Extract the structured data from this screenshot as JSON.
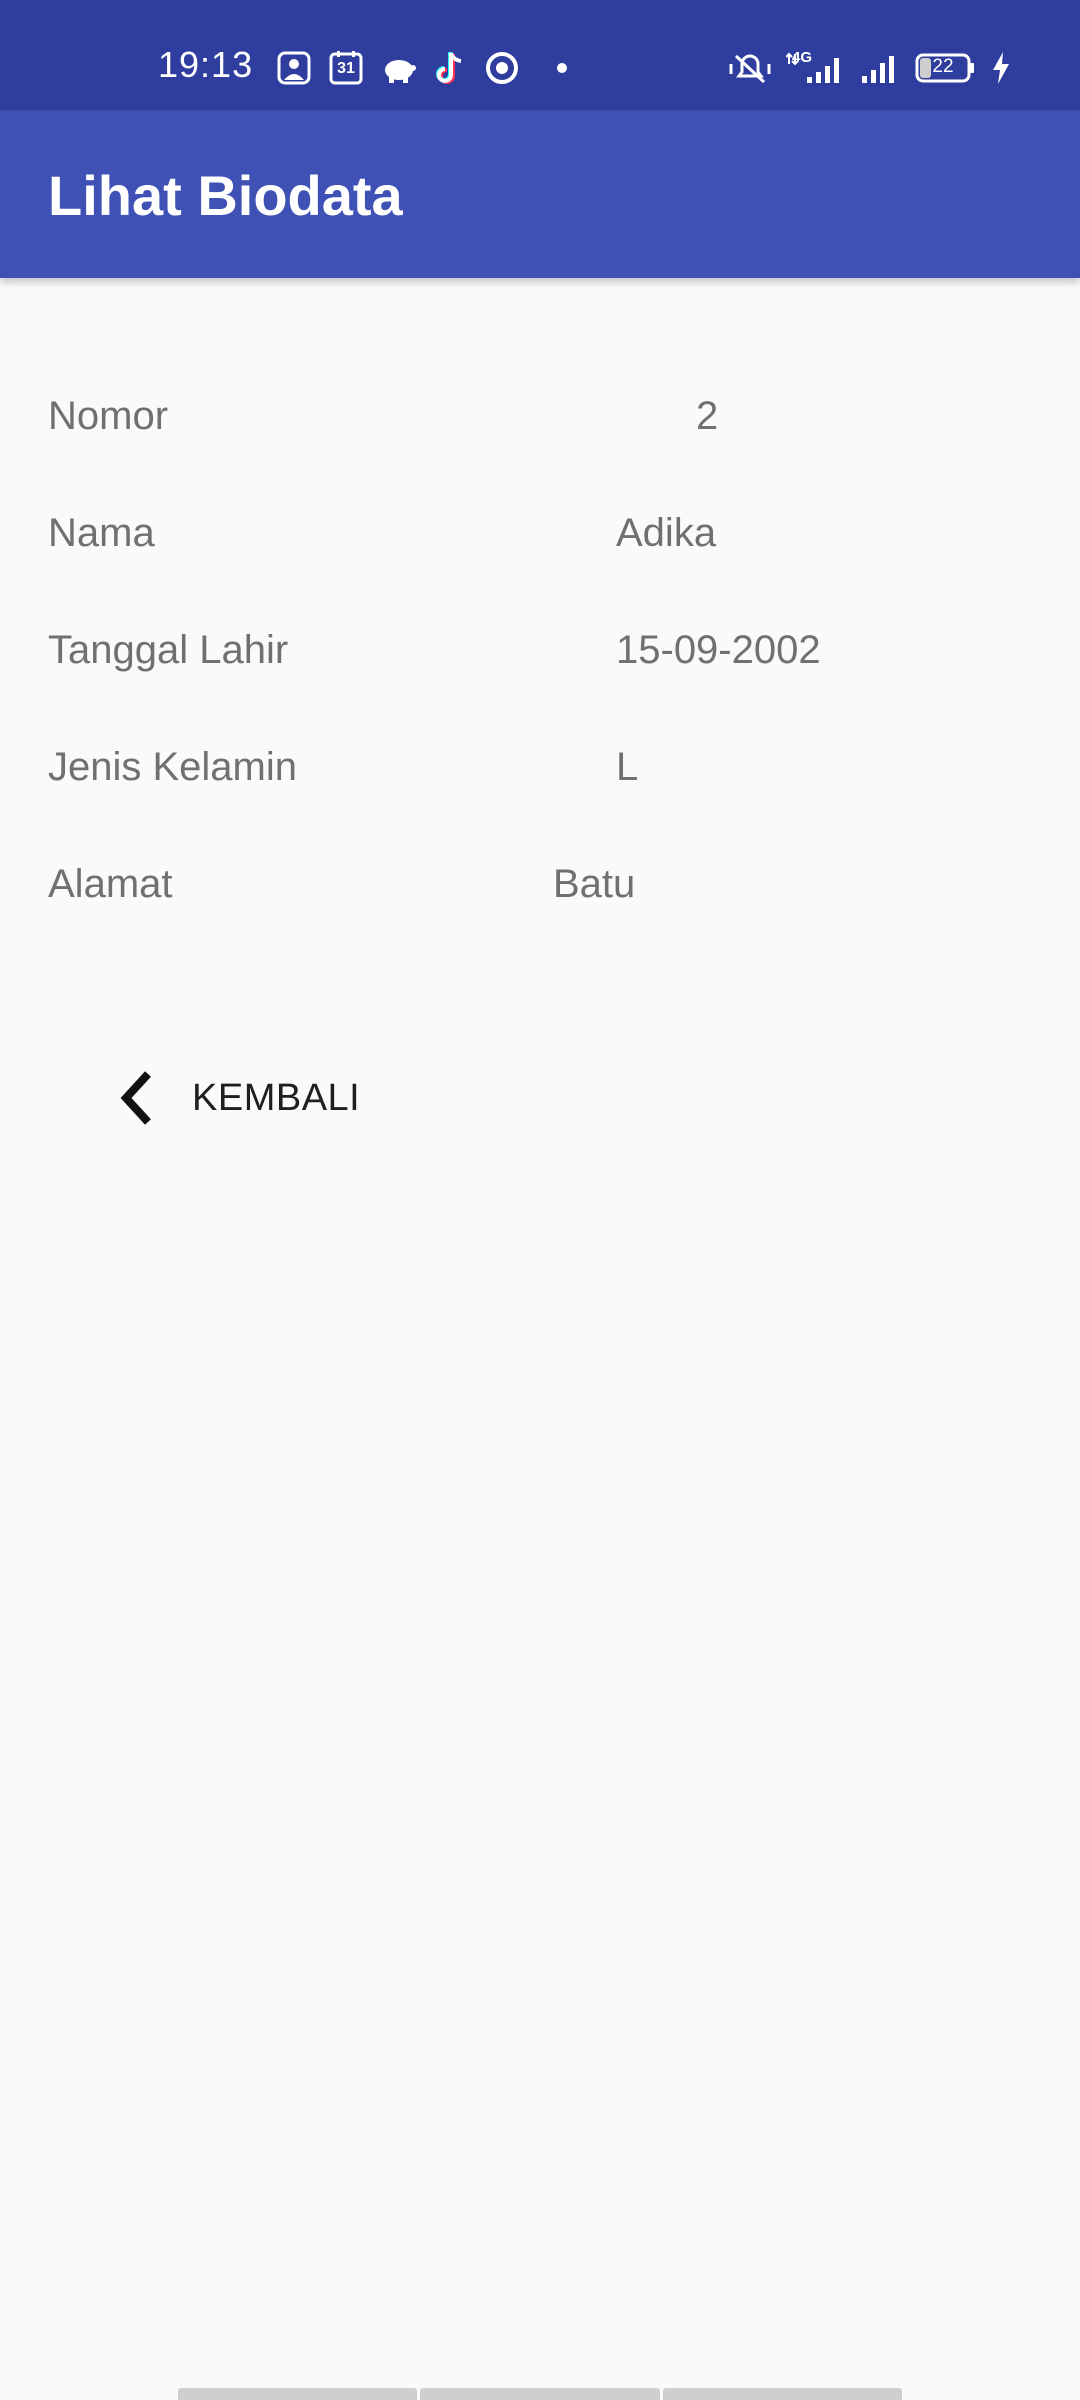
{
  "status_bar": {
    "time": "19:13",
    "left_icons": [
      "photo-app-icon",
      "calendar-31-icon",
      "piggy-bank-icon",
      "tiktok-icon",
      "target-app-icon",
      "notification-dot-icon"
    ],
    "calendar_day": "31",
    "right_icons": [
      "vibrate-icon",
      "4g-signal-icon",
      "signal-icon",
      "battery-icon",
      "charging-icon"
    ],
    "network_type": "4G",
    "battery_level": "22",
    "colors": {
      "background": "#2f3e9e",
      "foreground": "#ffffff"
    }
  },
  "app_bar": {
    "title": "Lihat Biodata",
    "color": "#3f51b5"
  },
  "biodata": {
    "fields": [
      {
        "label": "Nomor",
        "value": "2"
      },
      {
        "label": "Nama",
        "value": "Adika"
      },
      {
        "label": "Tanggal Lahir",
        "value": "15-09-2002"
      },
      {
        "label": "Jenis Kelamin",
        "value": "L"
      },
      {
        "label": "Alamat",
        "value": "Batu"
      }
    ]
  },
  "back_button": {
    "label": "KEMBALI",
    "icon": "chevron-left-icon"
  },
  "colors": {
    "page_background": "#fafafa",
    "field_text": "#707070",
    "button_text": "#1f1f1f"
  }
}
